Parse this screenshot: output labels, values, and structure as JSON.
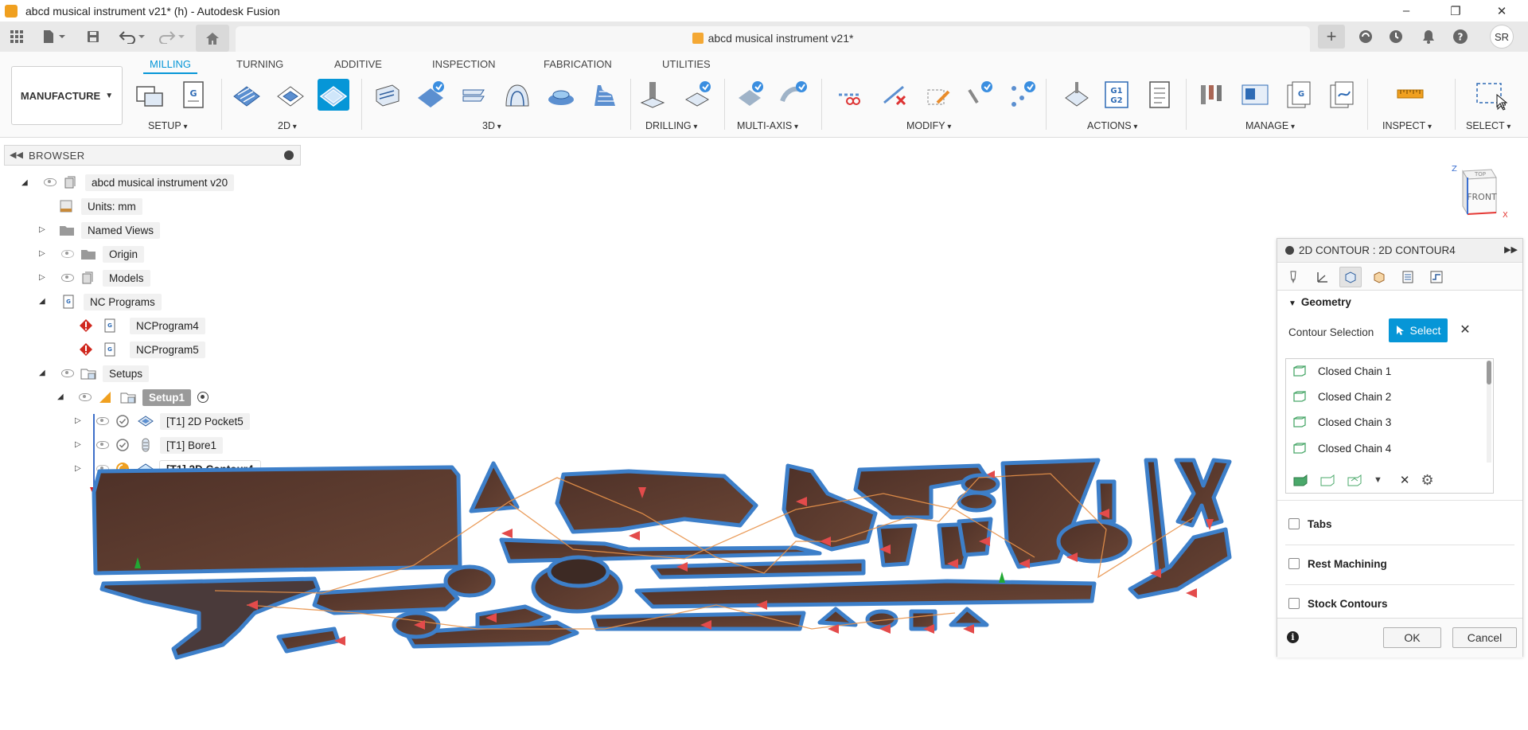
{
  "window": {
    "title": "abcd musical instrument v21* (h) - Autodesk Fusion",
    "document_tab": "abcd musical instrument v21*",
    "user_initials": "SR"
  },
  "ribbon": {
    "workspace": "MANUFACTURE",
    "tabs": [
      "MILLING",
      "TURNING",
      "ADDITIVE",
      "INSPECTION",
      "FABRICATION",
      "UTILITIES"
    ],
    "active_tab": "MILLING",
    "groups": [
      "SETUP",
      "2D",
      "3D",
      "DRILLING",
      "MULTI-AXIS",
      "MODIFY",
      "ACTIONS",
      "MANAGE",
      "INSPECT",
      "SELECT"
    ],
    "g1g2_label_1": "G1",
    "g1g2_label_2": "G2"
  },
  "browser": {
    "title": "BROWSER",
    "root": "abcd musical instrument v20",
    "units": "Units: mm",
    "named_views": "Named Views",
    "origin": "Origin",
    "models": "Models",
    "nc_programs": "NC Programs",
    "ncprogram4": "NCProgram4",
    "ncprogram5": "NCProgram5",
    "setups": "Setups",
    "setup1": "Setup1",
    "op1": "[T1] 2D Pocket5",
    "op2": "[T1] Bore1",
    "op3": "[T1] 2D Contour4"
  },
  "viewcube": {
    "top": "TOP",
    "front": "FRONT",
    "axis_x": "X",
    "axis_z": "Z"
  },
  "panel": {
    "title": "2D CONTOUR : 2D CONTOUR4",
    "geometry_section": "Geometry",
    "contour_selection_label": "Contour Selection",
    "select_button": "Select",
    "chains": [
      "Closed Chain 1",
      "Closed Chain 2",
      "Closed Chain 3",
      "Closed Chain 4"
    ],
    "tabs_option": "Tabs",
    "rest_machining_option": "Rest Machining",
    "stock_contours_option": "Stock Contours",
    "ok_button": "OK",
    "cancel_button": "Cancel"
  },
  "colors": {
    "accent": "#0696d7",
    "wood": "#5a3a2e",
    "part_outline": "#3d7fc9",
    "toolpath_arrow": "#e34b4b",
    "toolpath_link": "#e8924a"
  }
}
